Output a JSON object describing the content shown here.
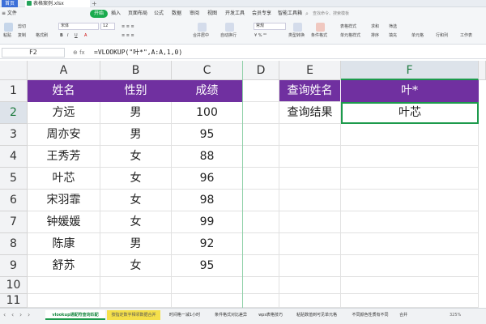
{
  "titlebar": {
    "home_tab": "首页",
    "file_name": "表格案例.xlsx",
    "add_tab": "+"
  },
  "menubar": {
    "file_menu": "≡ 文件",
    "items": [
      "开始",
      "插入",
      "页面布局",
      "公式",
      "数据",
      "审阅",
      "视图",
      "开发工具",
      "会员专享",
      "智能工具箱"
    ],
    "search_placeholder": "查找命令、搜索模板"
  },
  "toolbar": {
    "paste": "粘贴",
    "cut": "剪切",
    "copy": "复制",
    "format_painter": "格式刷",
    "font_name": "宋体",
    "font_size": "12",
    "merge_center": "合并居中",
    "wrap_text": "自动换行",
    "number_format": "常规",
    "type_convert": "类型转换",
    "conditional_format": "条件格式",
    "table_style": "表格样式",
    "cell_style": "单元格样式",
    "sum": "求和",
    "filter": "筛选",
    "sort": "排序",
    "fill": "填充",
    "cell": "单元格",
    "row_col": "行和列",
    "worksheet": "工作表"
  },
  "formula_bar": {
    "cell_ref": "F2",
    "formula": "=VLOOKUP(\"叶*\",A:A,1,0)"
  },
  "columns": [
    "A",
    "B",
    "C",
    "D",
    "E",
    "F"
  ],
  "rows": [
    "1",
    "2",
    "3",
    "4",
    "5",
    "6",
    "7",
    "8",
    "9",
    "10",
    "11"
  ],
  "table": {
    "headers": [
      "姓名",
      "性别",
      "成绩"
    ],
    "data": [
      [
        "方远",
        "男",
        "100"
      ],
      [
        "周亦安",
        "男",
        "95"
      ],
      [
        "王秀芳",
        "女",
        "88"
      ],
      [
        "叶芯",
        "女",
        "96"
      ],
      [
        "宋羽霏",
        "女",
        "98"
      ],
      [
        "钟媛媛",
        "女",
        "99"
      ],
      [
        "陈康",
        "男",
        "92"
      ],
      [
        "舒苏",
        "女",
        "95"
      ]
    ]
  },
  "lookup": {
    "query_label": "查询姓名",
    "query_value": "叶*",
    "result_label": "查询结果",
    "result_value": "叶芯"
  },
  "sheet_tabs": [
    {
      "label": "vlookup通配符查询匹配"
    },
    {
      "label": "按指定数字相邻数据合并"
    },
    {
      "label": "时间格一减1小时"
    },
    {
      "label": "条件格式对比差异"
    },
    {
      "label": "wps表格技巧"
    },
    {
      "label": "粘贴数值到可见单元格"
    },
    {
      "label": "不同颜色性质有不同"
    },
    {
      "label": "合并"
    }
  ],
  "zoom": "325%",
  "colors": {
    "header_purple": "#7030a0",
    "accent_green": "#1d9a4c",
    "tab_yellow": "#f5e04a"
  }
}
